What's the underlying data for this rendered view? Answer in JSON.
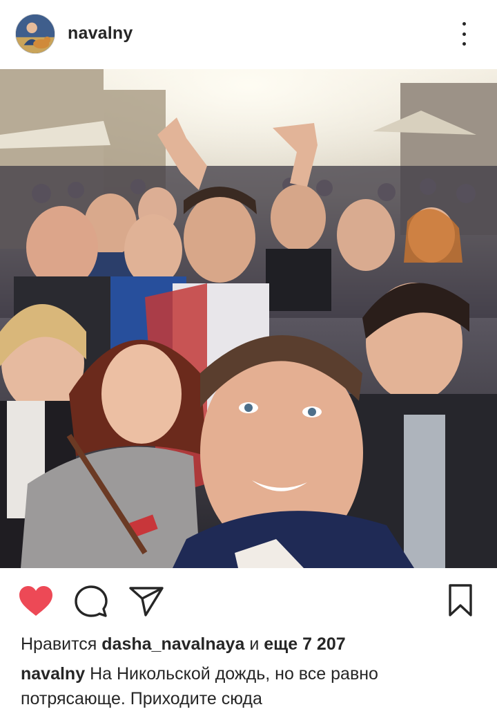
{
  "header": {
    "username": "navalny",
    "avatar_icon": "profile-avatar",
    "more_icon": "more-vertical-icon"
  },
  "photo": {
    "subject": "selfie"
  },
  "actions": {
    "like_icon": "heart-filled-icon",
    "like_color": "#ed4956",
    "comment_icon": "comment-icon",
    "share_icon": "send-icon",
    "save_icon": "bookmark-icon"
  },
  "likes": {
    "prefix": "Нравится",
    "user": "dasha_navalnaya",
    "conjunction": "и",
    "more": "еще 7 207"
  },
  "caption": {
    "author": "navalny",
    "text": "На Никольской дождь, но все равно потрясающе. Приходите сюда"
  }
}
